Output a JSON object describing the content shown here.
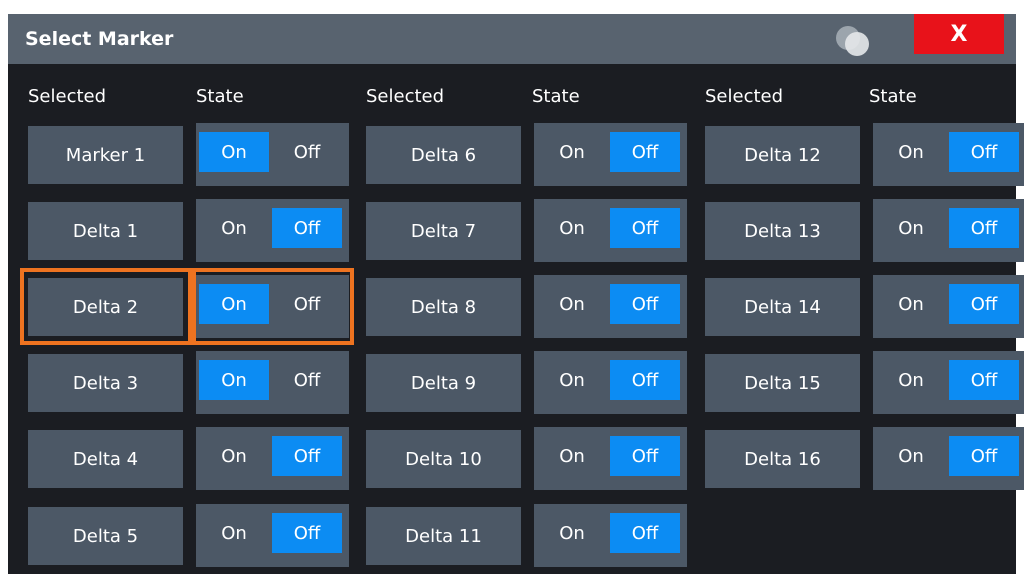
{
  "dialog": {
    "title": "Select Marker",
    "close_label": "X",
    "colors": {
      "title_bg": "#58636f",
      "body_bg": "#1b1d22",
      "button_bg": "#4c5866",
      "active_blue": "#0c8cf3",
      "close_red": "#e8121a",
      "focus_orange": "#ee7320"
    }
  },
  "headers": {
    "selected": "Selected",
    "state": "State"
  },
  "toggle_labels": {
    "on": "On",
    "off": "Off"
  },
  "markers": [
    {
      "label": "Marker 1",
      "state": "On"
    },
    {
      "label": "Delta 1",
      "state": "Off"
    },
    {
      "label": "Delta 2",
      "state": "On",
      "focused": true
    },
    {
      "label": "Delta 3",
      "state": "On"
    },
    {
      "label": "Delta 4",
      "state": "Off"
    },
    {
      "label": "Delta 5",
      "state": "Off"
    },
    {
      "label": "Delta 6",
      "state": "Off"
    },
    {
      "label": "Delta 7",
      "state": "Off"
    },
    {
      "label": "Delta 8",
      "state": "Off"
    },
    {
      "label": "Delta 9",
      "state": "Off"
    },
    {
      "label": "Delta 10",
      "state": "Off"
    },
    {
      "label": "Delta 11",
      "state": "Off"
    },
    {
      "label": "Delta 12",
      "state": "Off"
    },
    {
      "label": "Delta 13",
      "state": "Off"
    },
    {
      "label": "Delta 14",
      "state": "Off"
    },
    {
      "label": "Delta 15",
      "state": "Off"
    },
    {
      "label": "Delta 16",
      "state": "Off"
    }
  ]
}
